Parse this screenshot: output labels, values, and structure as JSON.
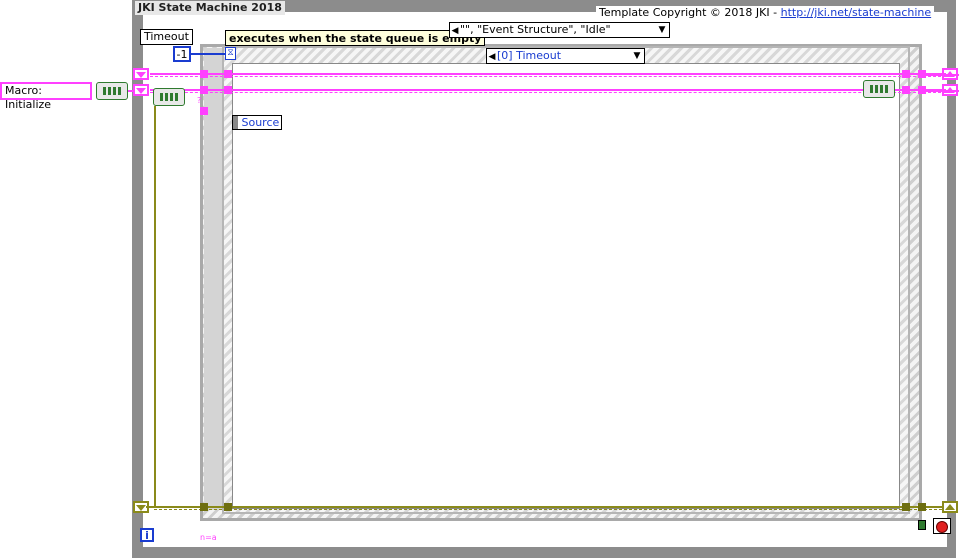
{
  "loop": {
    "title": "JKI State Machine 2018",
    "copyright_prefix": "Template Copyright © 2018 JKI - ",
    "copyright_link": "http://jki.net/state-machine",
    "iteration_label": "i"
  },
  "constants": {
    "macro_initialize": "Macro: Initialize",
    "timeout_label": "Timeout",
    "timeout_value": "-1"
  },
  "case_structure": {
    "comment": "executes when the state queue is empty",
    "selector_value": "\"\", \"Event Structure\", \"Idle\""
  },
  "event_structure": {
    "selector_value": "[0] Timeout",
    "node_label": "Source",
    "error_label": "?",
    "n_label": "n=a"
  },
  "colors": {
    "string_wire": "#ff40ff",
    "error_wire": "#8a8a1a",
    "numeric_wire": "#1a3cd0",
    "frame": "#8c8c8c"
  }
}
